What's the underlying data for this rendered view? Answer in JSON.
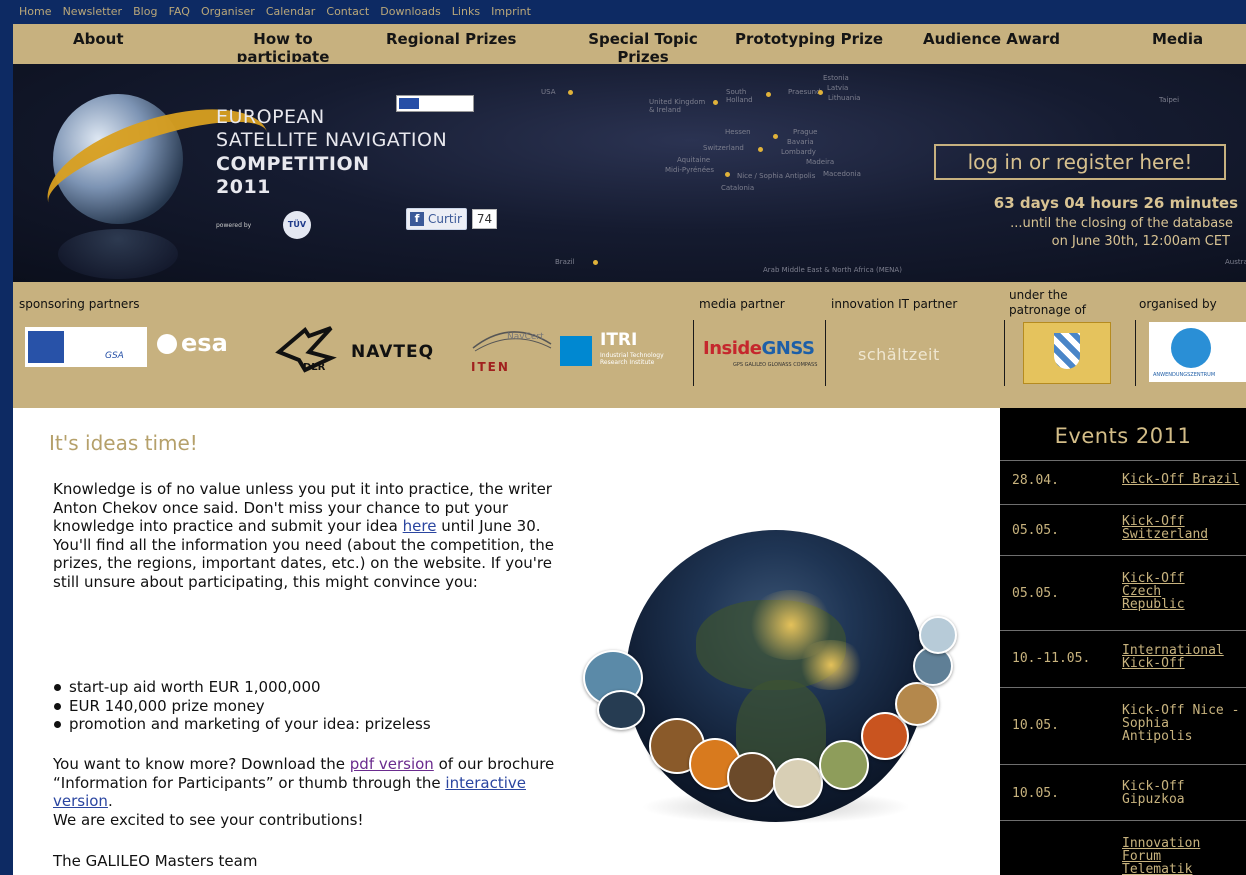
{
  "top_links": [
    "Home",
    "Newsletter",
    "Blog",
    "FAQ",
    "Organiser",
    "Calendar",
    "Contact",
    "Downloads",
    "Links",
    "Imprint"
  ],
  "main_nav": [
    "About",
    "How to participate",
    "Regional Prizes",
    "Special Topic Prizes",
    "Prototyping Prize",
    "Audience Award",
    "Media"
  ],
  "banner": {
    "title_line1": "EUROPEAN",
    "title_line2": "SATELLITE NAVIGATION",
    "title_line3": "COMPETITION",
    "title_line4": "2011",
    "powered_by": "powered by",
    "tuv": "TÜV",
    "fb_like_label": "Curtir",
    "fb_icon": "f",
    "fb_like_count": "74",
    "login_label": "log in or register here!",
    "countdown": "63 days  04 hours 26 minutes",
    "countdown_sub1": "...until the closing of the database",
    "countdown_sub2": "on June 30th, 12:00am CET",
    "map_labels": [
      "USA",
      "United Kingdom & Ireland",
      "South Holland",
      "Praesund",
      "Estonia",
      "Latvia",
      "Lithuania",
      "Hessen",
      "Prague",
      "Bavaria",
      "Switzerland",
      "Lombardy",
      "Aquitaine",
      "Midi-Pyrénées",
      "Nice / Sophia Antipolis",
      "Madeira",
      "Macedonia",
      "Catalonia",
      "Brazil",
      "Arab Middle East & North Africa (MENA)",
      "Taipei",
      "Australia"
    ]
  },
  "partners": {
    "sponsoring_label": "sponsoring partners",
    "media_label": "media partner",
    "it_label": "innovation IT partner",
    "patronage_label_1": "under the",
    "patronage_label_2": "patronage of",
    "organised_label": "organised by",
    "gsa": "GSA",
    "esa": "esa",
    "dlr": "DLR",
    "navteq": "NAVTEQ",
    "navcert": "NavCert",
    "iten": "ITEN",
    "itri": "ITRI",
    "itri_sub": "Industrial Technology Research Institute",
    "insidegnss_a": "Inside",
    "insidegnss_b": "GNSS",
    "insidegnss_sub": "GPS GALILEO GLONASS COMPASS",
    "schaltzeit": "schältzeit",
    "anwendungszentrum": "ANWENDUNGSZENTRUM"
  },
  "article": {
    "title": "It's ideas time!",
    "intro_1": "Knowledge is of no value unless you put it into practice, the writer Anton Chekov once said. Don't miss your chance to put your knowledge into practice and submit your idea ",
    "intro_link": "here",
    "intro_2": " until June 30. You'll find all the information you need (about the competition, the prizes, the regions, important dates, etc.) on the website. If you're still unsure about participating, this might convince you:",
    "bullets": [
      "start-up aid worth EUR 1,000,000",
      "EUR 140,000 prize money",
      "promotion and marketing of your idea: prizeless"
    ],
    "more_1": "You want to know more? Download the ",
    "more_link1": "pdf version",
    "more_2": " of our brochure “Information for Participants” or thumb through the ",
    "more_link2": "interactive version",
    "more_3": ".",
    "more_4": "We are excited to see your contributions!",
    "signoff": "The GALILEO Masters team"
  },
  "events": {
    "title": "Events 2011",
    "items": [
      {
        "date": "28.04.",
        "name": "Kick-Off Brazil",
        "link": true
      },
      {
        "date": "05.05.",
        "name": "Kick-Off Switzerland",
        "link": true
      },
      {
        "date": "05.05.",
        "name": "Kick-Off Czech Republic",
        "link": true
      },
      {
        "date": "10.-11.05.",
        "name": "International Kick-Off",
        "link": true
      },
      {
        "date": "10.05.",
        "name": "Kick-Off Nice - Sophia Antipolis",
        "link": false
      },
      {
        "date": "10.05.",
        "name": "Kick-Off Gipuzkoa",
        "link": false
      },
      {
        "date": "",
        "name": "Innovation Forum Telematik /",
        "link": true
      }
    ]
  },
  "colors": {
    "page_border": "#0d2a63",
    "nav_gold": "#c7b17f",
    "banner_dark": "#111728",
    "events_bg": "#000000",
    "events_text": "#c8b37e",
    "title_gold": "#b5a06a"
  },
  "icons": [
    "globe-logo-icon",
    "eu-flag-icon",
    "facebook-icon",
    "bullet-icon"
  ]
}
